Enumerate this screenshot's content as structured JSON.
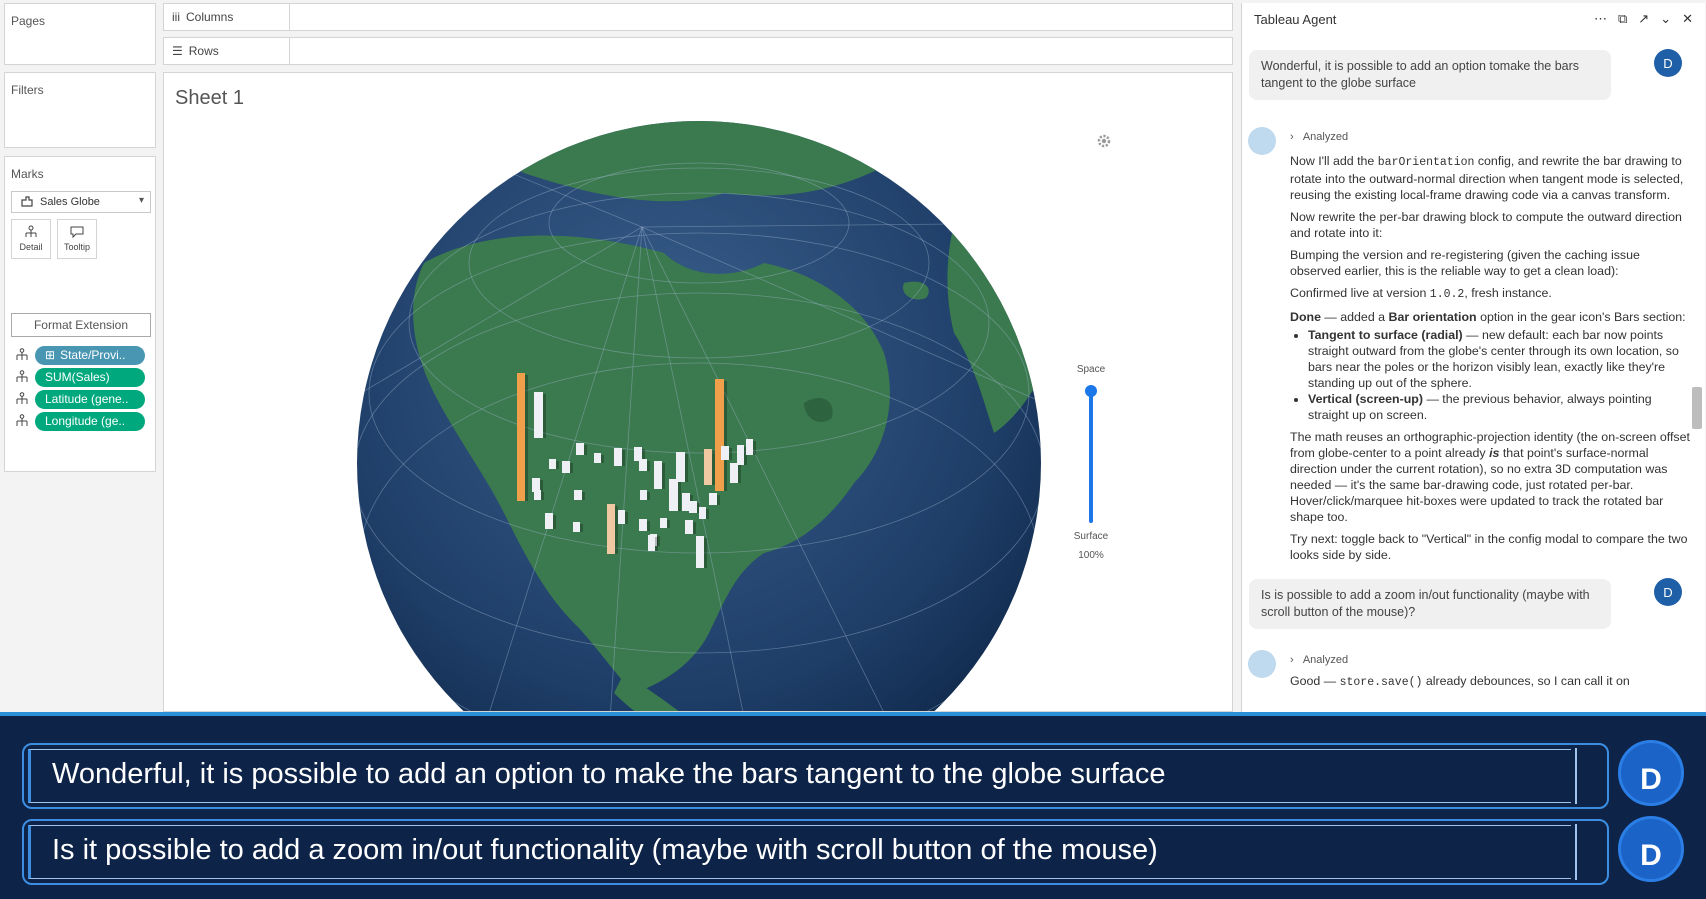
{
  "shelves": {
    "pages": "Pages",
    "filters": "Filters",
    "marks": "Marks",
    "mark_type": "Sales Globe",
    "mark_buttons": [
      "Detail",
      "Tooltip"
    ],
    "format_extension": "Format Extension",
    "pills": [
      {
        "label": "State/Provi..",
        "color": "#4996b2",
        "icon": "plus-box-icon"
      },
      {
        "label": "SUM(Sales)",
        "color": "#00a87e"
      },
      {
        "label": "Latitude (gene..",
        "color": "#00a87e"
      },
      {
        "label": "Longitude (ge..",
        "color": "#00a87e"
      }
    ],
    "columns": "Columns",
    "rows": "Rows"
  },
  "sheet": {
    "title": "Sheet 1",
    "slider": {
      "top_label": "Space",
      "bottom_label": "Surface",
      "value_text": "100%",
      "value": 1.0
    }
  },
  "agent": {
    "title": "Tableau Agent",
    "user_msg_1": "Wonderful, it is possible to add an option tomake the bars tangent to the globe surface",
    "analyzed": "Analyzed",
    "avatar": "D",
    "response": {
      "p1_a": "Now I'll add the ",
      "p1_code": "barOrientation",
      "p1_b": " config, and rewrite the bar drawing to rotate into the outward-normal direction when tangent mode is selected, reusing the existing local-frame drawing code via a canvas transform.",
      "p2": "Now rewrite the per-bar drawing block to compute the outward direction and rotate into it:",
      "p3": "Bumping the version and re-registering (given the caching issue observed earlier, this is the reliable way to get a clean load):",
      "p4_a": "Confirmed live at version ",
      "p4_code": "1.0.2",
      "p4_b": ", fresh instance.",
      "p5_done": "Done",
      "p5_a": " — added a ",
      "p5_bold": "Bar orientation",
      "p5_b": " option in the gear icon's Bars section:",
      "li1_bold": "Tangent to surface (radial)",
      "li1": " — new default: each bar now points straight outward from the globe's center through its own location, so bars near the poles or the horizon visibly lean, exactly like they're standing up out of the sphere.",
      "li2_bold": "Vertical (screen-up)",
      "li2": " — the previous behavior, always pointing straight up on screen.",
      "p6_a": "The math reuses an orthographic-projection identity (the on-screen offset from globe-center to a point already ",
      "p6_em": "is",
      "p6_b": " that point's surface-normal direction under the current rotation), so no extra 3D computation was needed — it's the same bar-drawing code, just rotated per-bar. Hover/click/marquee hit-boxes were updated to track the rotated bar shape too.",
      "p7": "Try next: toggle back to \"Vertical\" in the config modal to compare the two looks side by side."
    },
    "user_msg_2": "Is is possible to add a zoom in/out functionality (maybe with scroll button of the mouse)?",
    "analyzed_2": "Analyzed",
    "partial_a": "Good — ",
    "partial_code": "store.save()",
    "partial_b": " already debounces, so I can call it on"
  },
  "captions": [
    "Wonderful, it is possible to add an option to make the bars tangent to the globe surface",
    "Is it possible to add a zoom in/out functionality (maybe with scroll button of the mouse)"
  ],
  "caption_avatar": "D",
  "colors": {
    "ocean": "#1d3d66",
    "land": "#3b7a4e",
    "bar_orange": "#f0a04b",
    "bar_tan": "#f0c9a3",
    "bar_white": "#eef0f6",
    "overlay": "#0d2347",
    "accent": "#2a8fd6"
  }
}
